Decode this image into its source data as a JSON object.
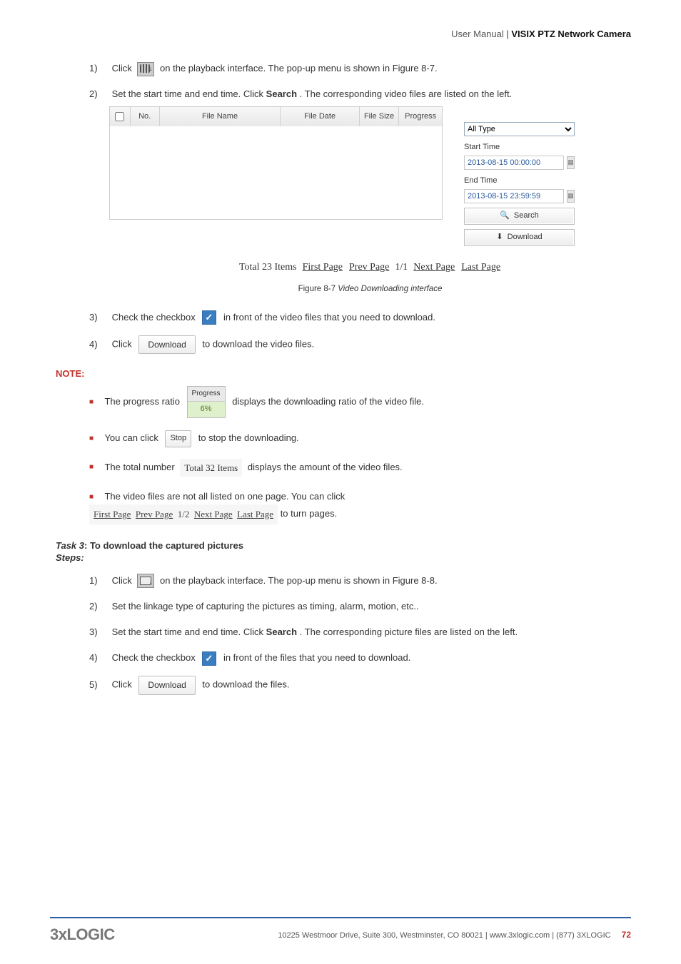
{
  "header": {
    "light": "User Manual",
    "divider": " | ",
    "bold": "VISIX PTZ Network Camera"
  },
  "step1": {
    "num": "1)",
    "t1": "Click ",
    "t2": " on the playback interface. The pop-up menu is shown in Figure 8-7."
  },
  "step2": {
    "num": "2)",
    "t1": "Set the start time and end time. Click ",
    "bold": "Search",
    "t2": ". The corresponding video files are listed on the left."
  },
  "filelist": {
    "cols": {
      "no": "No.",
      "name": "File Name",
      "date": "File Date",
      "size": "File Size",
      "prog": "Progress"
    }
  },
  "sidepanel": {
    "type_value": "All Type",
    "start_label": "Start Time",
    "start_value": "2013-08-15 00:00:00",
    "end_label": "End Time",
    "end_value": "2013-08-15 23:59:59",
    "search_label": "Search",
    "download_label": "Download"
  },
  "totals": {
    "total": "Total 23 Items",
    "first": "First Page",
    "prev": "Prev Page",
    "pos": "1/1",
    "next": "Next Page",
    "last": "Last Page"
  },
  "figcap": {
    "lead": "Figure 8-7 ",
    "title": "Video Downloading interface"
  },
  "step3": {
    "num": "3)",
    "t1": "Check the checkbox ",
    "t2": " in front of the video files that you need to download."
  },
  "step4": {
    "num": "4)",
    "t1": "Click ",
    "btn": "Download",
    "t2": " to download the video files."
  },
  "note_label": "NOTE:",
  "noteA": {
    "t1": "The progress ratio ",
    "ph": "Progress",
    "pv": "6%",
    "t2": " displays the downloading ratio of the video file."
  },
  "noteB": {
    "t1": "You can click ",
    "btn": "Stop",
    "t2": " to stop the downloading."
  },
  "noteC": {
    "t1": "The total number ",
    "badge": "Total 32 Items",
    "t2": " displays the amount of the video files."
  },
  "noteD": {
    "t1": "The video files are not all listed on one page. You can click",
    "pager": {
      "first": "First Page",
      "prev": "Prev Page",
      "pos": "1/2",
      "next": "Next Page",
      "last": "Last Page"
    },
    "t2": " to turn pages."
  },
  "task3": {
    "lead": "Task 3",
    "rest": ": To download the captured pictures"
  },
  "steps_label": "Steps:",
  "b1": {
    "num": "1)",
    "t1": "Click ",
    "t2": " on the playback interface. The pop-up menu is shown in Figure 8-8."
  },
  "b2": {
    "num": "2)",
    "t": "Set the linkage type of capturing the pictures as timing, alarm, motion, etc.."
  },
  "b3": {
    "num": "3)",
    "t1": "Set the start time and end time. Click ",
    "bold": "Search",
    "t2": ". The corresponding picture files are listed on the left."
  },
  "b4": {
    "num": "4)",
    "t1": "Check the checkbox ",
    "t2": " in front of the files that you need to download."
  },
  "b5": {
    "num": "5)",
    "t1": "Click ",
    "btn": "Download",
    "t2": " to download the files."
  },
  "footer": {
    "logo": "3xLOGIC",
    "addr": "10225 Westmoor Drive, Suite 300, Westminster, CO 80021 | www.3xlogic.com | (877) 3XLOGIC",
    "page": "72"
  }
}
